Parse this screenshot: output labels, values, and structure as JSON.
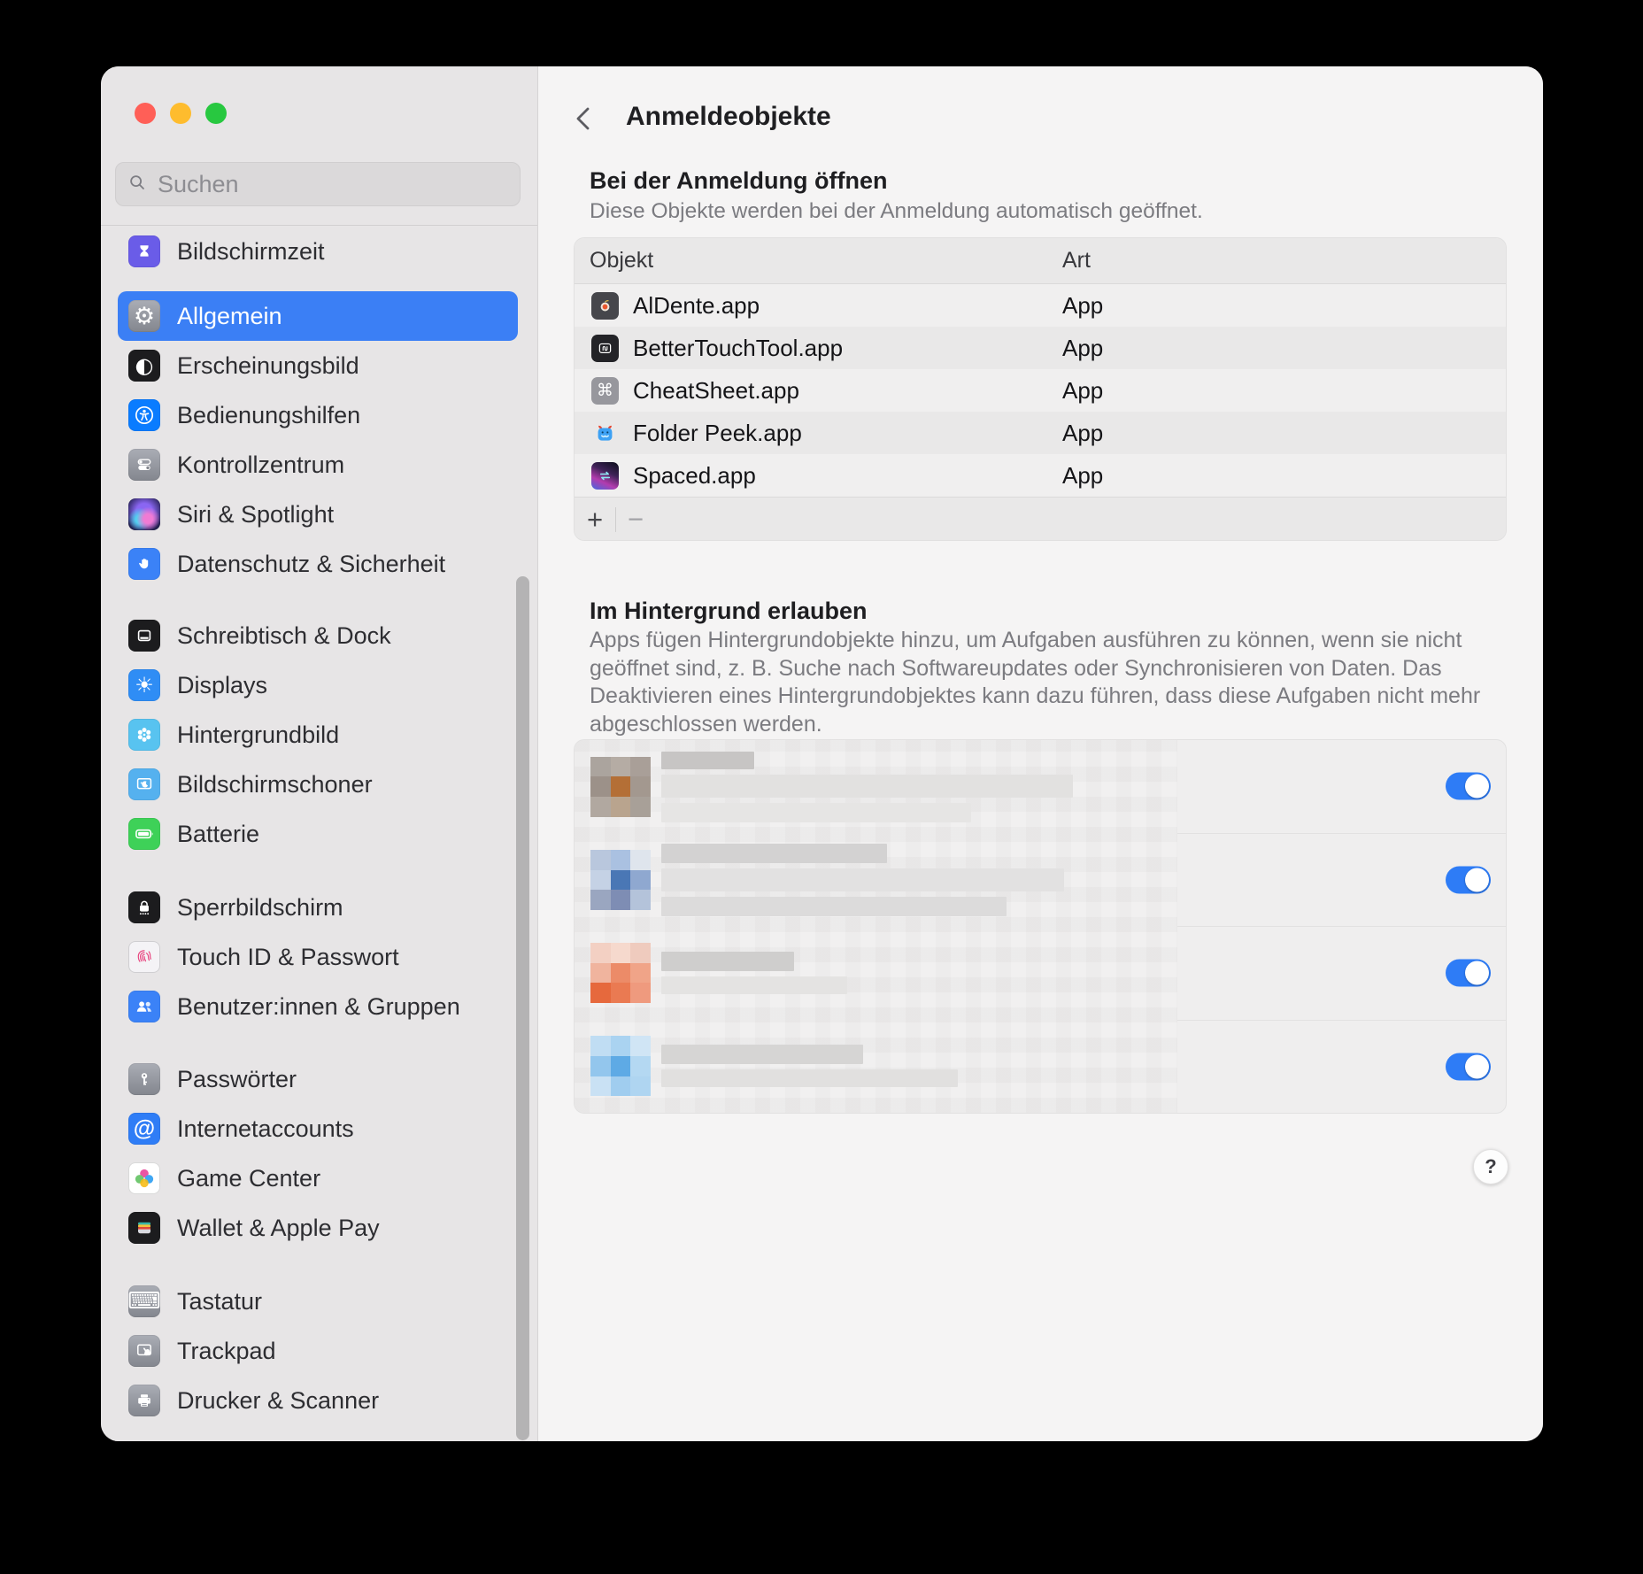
{
  "theme": {
    "accent": "#3b7ff5",
    "toggle_on": "#2e7cf6",
    "traffic_lights": [
      "#ff5f57",
      "#febc2e",
      "#28c840"
    ]
  },
  "sidebar": {
    "search_placeholder": "Suchen",
    "selected": "allgemein",
    "groups": [
      {
        "items": [
          {
            "id": "bildschirmzeit",
            "label": "Bildschirmzeit",
            "icon": "hourglass-icon",
            "color": "#6a5ce8"
          }
        ]
      },
      {
        "items": [
          {
            "id": "allgemein",
            "label": "Allgemein",
            "icon": "gear-icon",
            "color": "#8e8e96"
          },
          {
            "id": "erscheinungsbild",
            "label": "Erscheinungsbild",
            "icon": "appearance-icon",
            "color": "#1c1c1e"
          },
          {
            "id": "bedienungshilfen",
            "label": "Bedienungshilfen",
            "icon": "accessibility-icon",
            "color": "#0a7cff"
          },
          {
            "id": "kontrollzentrum",
            "label": "Kontrollzentrum",
            "icon": "control-center-icon",
            "color": "#9194a0"
          },
          {
            "id": "siri",
            "label": "Siri & Spotlight",
            "icon": "siri-orb-icon",
            "color": "#232050"
          },
          {
            "id": "datenschutz",
            "label": "Datenschutz & Sicherheit",
            "icon": "hand-icon",
            "color": "#3b82f7"
          }
        ]
      },
      {
        "items": [
          {
            "id": "schreibtisch",
            "label": "Schreibtisch & Dock",
            "icon": "desktop-dock-icon",
            "color": "#1c1c1e"
          },
          {
            "id": "displays",
            "label": "Displays",
            "icon": "sun-icon",
            "color": "#2f8df5"
          },
          {
            "id": "hintergrundbild",
            "label": "Hintergrundbild",
            "icon": "flower-icon",
            "color": "#58c3f0"
          },
          {
            "id": "bildschirmschoner",
            "label": "Bildschirmschoner",
            "icon": "screensaver-moon-icon",
            "color": "#55b1ef"
          },
          {
            "id": "batterie",
            "label": "Batterie",
            "icon": "battery-icon",
            "color": "#3ed158"
          }
        ]
      },
      {
        "items": [
          {
            "id": "sperrbildschirm",
            "label": "Sperrbildschirm",
            "icon": "lock-icon",
            "color": "#1c1c1e"
          },
          {
            "id": "touchid",
            "label": "Touch ID & Passwort",
            "icon": "fingerprint-icon",
            "color": "#f4f3f6"
          },
          {
            "id": "benutzer",
            "label": "Benutzer:innen & Gruppen",
            "icon": "users-icon",
            "color": "#3b82f7"
          }
        ]
      },
      {
        "items": [
          {
            "id": "passwoerter",
            "label": "Passwörter",
            "icon": "key-icon",
            "color": "#8e8e96"
          },
          {
            "id": "internet",
            "label": "Internetaccounts",
            "icon": "at-sign-icon",
            "color": "#2f7df6"
          },
          {
            "id": "gamecenter",
            "label": "Game Center",
            "icon": "game-center-bubbles-icon",
            "color": "#ffffff"
          },
          {
            "id": "wallet",
            "label": "Wallet & Apple Pay",
            "icon": "wallet-icon",
            "color": "#1c1c1e"
          }
        ]
      },
      {
        "items": [
          {
            "id": "tastatur",
            "label": "Tastatur",
            "icon": "keyboard-icon",
            "color": "#90939e"
          },
          {
            "id": "trackpad",
            "label": "Trackpad",
            "icon": "trackpad-icon",
            "color": "#9b9ea8"
          },
          {
            "id": "drucker",
            "label": "Drucker & Scanner",
            "icon": "printer-icon",
            "color": "#9b9ea8"
          }
        ]
      }
    ]
  },
  "content": {
    "title": "Anmeldeobjekte",
    "open_section": {
      "heading": "Bei der Anmeldung öffnen",
      "subtitle": "Diese Objekte werden bei der Anmeldung automatisch geöffnet.",
      "columns": [
        "Objekt",
        "Art"
      ],
      "rows": [
        {
          "id": "aldente",
          "name": "AlDente.app",
          "kind": "App",
          "icon": "aldente-app-icon"
        },
        {
          "id": "btt",
          "name": "BetterTouchTool.app",
          "kind": "App",
          "icon": "bettertouchtool-app-icon"
        },
        {
          "id": "cheatsheet",
          "name": "CheatSheet.app",
          "kind": "App",
          "icon": "cheatsheet-app-icon"
        },
        {
          "id": "folderpeek",
          "name": "Folder Peek.app",
          "kind": "App",
          "icon": "folder-peek-app-icon"
        },
        {
          "id": "spaced",
          "name": "Spaced.app",
          "kind": "App",
          "icon": "spaced-app-icon"
        }
      ],
      "add_label": "+",
      "remove_label": "−"
    },
    "background_section": {
      "heading": "Im Hintergrund erlauben",
      "description_lines": [
        "Apps fügen Hintergrundobjekte hinzu, um Aufgaben ausführen zu können, wenn sie nicht",
        "geöffnet sind, z. B. Suche nach Softwareupdates oder Synchronisieren von Daten. Das",
        "Deaktivieren eines Hintergrundobjektes kann dazu führen, dass diese Aufgaben nicht mehr",
        "abgeschlossen werden."
      ],
      "items": [
        {
          "enabled": true,
          "icon_cells": [
            "#aba49e",
            "#b5aca4",
            "#a99f98",
            "#9c9189",
            "#b46f36",
            "#a3988f",
            "#b1a8a0",
            "#b9a48e",
            "#a8a098"
          ],
          "strips": [
            [
              105,
              20,
              "#c7c5c4"
            ],
            [
              465,
              26,
              "#e2e1e0"
            ],
            [
              350,
              22,
              "#e6e5e4"
            ]
          ]
        },
        {
          "enabled": true,
          "icon_cells": [
            "#b9c7dd",
            "#aac1e1",
            "#dfe5ed",
            "#c5d2e5",
            "#4a77b5",
            "#8fa8d0",
            "#9aa6c0",
            "#7e8db4",
            "#b4c3da"
          ],
          "strips": [
            [
              255,
              22,
              "#d3d2d2"
            ],
            [
              455,
              26,
              "#e2e1e1"
            ],
            [
              390,
              22,
              "#dcdbdb"
            ]
          ]
        },
        {
          "enabled": true,
          "icon_cells": [
            "#f3d0c3",
            "#f6d9cd",
            "#efcbbe",
            "#f0b49e",
            "#ec8b68",
            "#f0a488",
            "#e6693d",
            "#ea7a52",
            "#ef9a7e"
          ],
          "strips": [
            [
              150,
              22,
              "#cfcecd"
            ],
            [
              210,
              20,
              "#e4e3e2"
            ]
          ]
        },
        {
          "enabled": true,
          "icon_cells": [
            "#c0ddf3",
            "#aad3f1",
            "#d0e5f5",
            "#93c6ed",
            "#5eaae5",
            "#b4d8f2",
            "#c9e1f4",
            "#a0cdef",
            "#afd5f1"
          ],
          "strips": [
            [
              228,
              22,
              "#d6d5d4"
            ],
            [
              335,
              20,
              "#e1e0df"
            ]
          ]
        }
      ]
    },
    "help_label": "?"
  }
}
